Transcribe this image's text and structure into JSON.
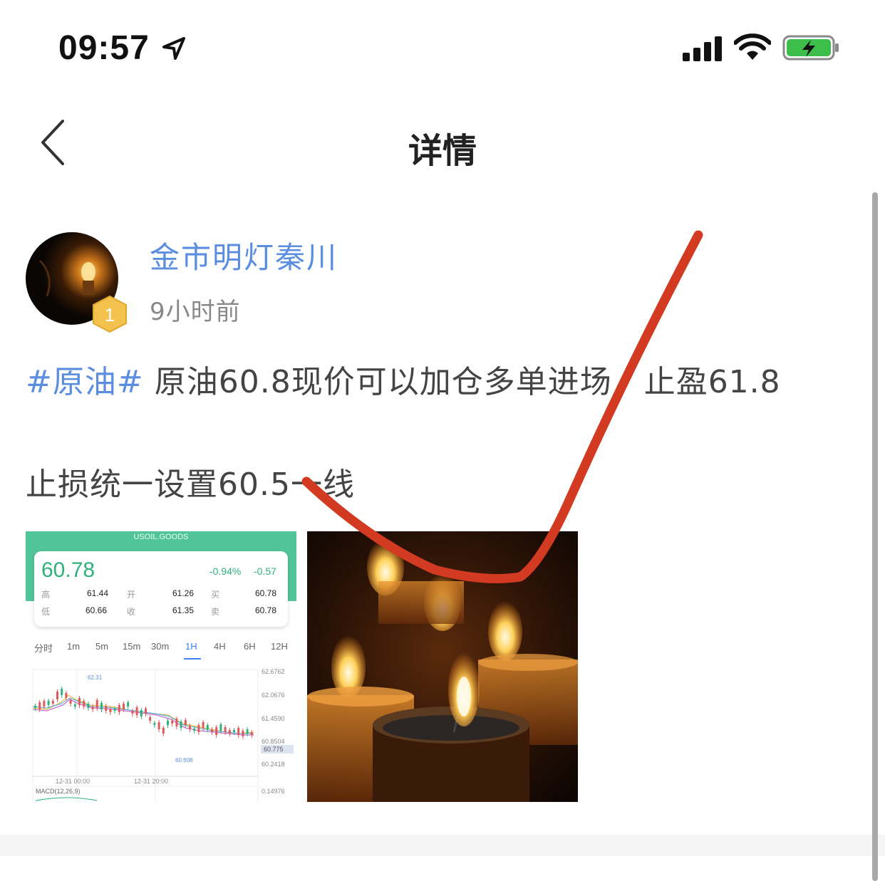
{
  "status_bar": {
    "time": "09:57",
    "icons": [
      "location-arrow-icon",
      "cellular-signal-icon",
      "wifi-icon",
      "battery-charging-icon"
    ]
  },
  "nav": {
    "title": "详情",
    "back_icon": "chevron-left-icon"
  },
  "author": {
    "name": "金市明灯秦川",
    "time": "9小时前",
    "rank": "1"
  },
  "post": {
    "hashtag": "#原油#",
    "line1": " 原油60.8现价可以加仓多单进场，止盈61.8",
    "line2": "止损统一设置60.5一线"
  },
  "chart_image": {
    "symbol": "USOIL.GOODS",
    "price": "60.78",
    "change_pct": "-0.94%",
    "change": "-0.57",
    "labels": {
      "high": "高",
      "low": "低",
      "open": "开",
      "close": "收",
      "buy": "买",
      "sell": "卖"
    },
    "values": {
      "high": "61.44",
      "low": "60.66",
      "open": "61.26",
      "close": "61.35",
      "buy": "60.78",
      "sell": "60.78"
    },
    "tabs": [
      "分时",
      "1m",
      "5m",
      "15m",
      "30m",
      "1H",
      "4H",
      "6H",
      "12H"
    ],
    "active_tab": "1H",
    "y_ticks": [
      "62.6762",
      "62.0676",
      "61.4590",
      "60.8504",
      "60.2418"
    ],
    "current_price_tag": "60.775",
    "max_label": "62.31",
    "min_label": "60.608",
    "x_ticks": [
      "12-31 00:00",
      "12-31 20:00"
    ],
    "macd_label": "MACD(12,26,9)",
    "macd_value": "0.14976"
  },
  "colors": {
    "accent_blue": "#5b8de0",
    "chart_green": "#52c49a",
    "annotation_red": "#d33a22"
  }
}
